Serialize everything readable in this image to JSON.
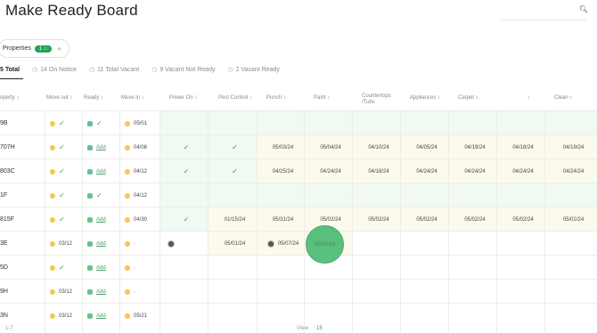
{
  "page": {
    "title": "Make Ready Board"
  },
  "search": {
    "placeholder": ""
  },
  "properties_filter": {
    "label": "Properties",
    "count": "1",
    "add": "+"
  },
  "tabs": [
    {
      "label": "5 Total",
      "icon": ""
    },
    {
      "label": "14 On Notice",
      "icon": "clock-icon"
    },
    {
      "label": "11 Total Vacant",
      "icon": "clock-icon"
    },
    {
      "label": "9 Vacant Not Ready",
      "icon": "clock-icon"
    },
    {
      "label": "2 Vacant Ready",
      "icon": "clock-icon"
    }
  ],
  "columns": [
    "operty ↕",
    "Move out ↕",
    "Ready ↕",
    "Move in ↕",
    "Power On ↕",
    "Pest Control ↕",
    "Punch ↕",
    "Paint ↕",
    "Countertops /Tubs",
    "Appliances ↕",
    "Carpet ↕",
    "↕",
    "Clean ↕"
  ],
  "rows": [
    {
      "property": "9B",
      "moveout_date": "",
      "ready": "check",
      "movein": "05/01",
      "power": "",
      "pest": "",
      "punch": "",
      "paint": "",
      "counter": "",
      "appl": "",
      "carpet": "",
      "col11": "",
      "clean": ""
    },
    {
      "property": "707H",
      "moveout_date": "",
      "ready": "add",
      "movein": "04/08",
      "power": "check",
      "pest": "check",
      "punch": "05/03/24",
      "paint": "05/04/24",
      "counter": "04/10/24",
      "appl": "04/05/24",
      "carpet": "04/19/24",
      "col11": "04/18/24",
      "clean": "04/19/24"
    },
    {
      "property": "803C",
      "moveout_date": "",
      "ready": "add",
      "movein": "04/12",
      "power": "check",
      "pest": "check",
      "punch": "04/25/24",
      "paint": "04/24/24",
      "counter": "04/18/24",
      "appl": "04/24/24",
      "carpet": "04/24/24",
      "col11": "04/24/24",
      "clean": "04/24/24"
    },
    {
      "property": "1F",
      "moveout_date": "",
      "ready": "check",
      "movein": "04/12",
      "power": "",
      "pest": "",
      "punch": "",
      "paint": "",
      "counter": "",
      "appl": "",
      "carpet": "",
      "col11": "",
      "clean": ""
    },
    {
      "property": "815F",
      "moveout_date": "",
      "ready": "add",
      "movein": "04/30",
      "power": "check",
      "pest": "01/15/24",
      "punch": "05/31/24",
      "paint": "05/02/24",
      "counter": "05/02/24",
      "appl": "05/02/24",
      "carpet": "05/02/24",
      "col11": "05/02/24",
      "clean": "05/02/24"
    },
    {
      "property": "3E",
      "moveout_date": "03/12",
      "ready": "add",
      "movein": "-",
      "power": "avatar",
      "pest": "05/01/24",
      "punch": "05/07/24",
      "paint": "05/02/24",
      "counter": "",
      "appl": "",
      "carpet": "",
      "col11": "",
      "clean": ""
    },
    {
      "property": "5D",
      "moveout_date": "",
      "ready": "add",
      "movein": "-",
      "power": "",
      "pest": "",
      "punch": "",
      "paint": "",
      "counter": "",
      "appl": "",
      "carpet": "",
      "col11": "",
      "clean": ""
    },
    {
      "property": "9H",
      "moveout_date": "03/12",
      "ready": "add",
      "movein": "-",
      "power": "",
      "pest": "",
      "punch": "",
      "paint": "",
      "counter": "",
      "appl": "",
      "carpet": "",
      "col11": "",
      "clean": ""
    },
    {
      "property": "3N",
      "moveout_date": "03/12",
      "ready": "add",
      "movein": "05/21",
      "power": "",
      "pest": "",
      "punch": "",
      "paint": "",
      "counter": "",
      "appl": "",
      "carpet": "",
      "col11": "",
      "clean": ""
    }
  ],
  "labels": {
    "add": "Add",
    "check": "✓",
    "dash": "-"
  },
  "footer": {
    "pagination": "1-7",
    "view_label": "View",
    "view_value": "15"
  },
  "colors": {
    "accent": "#22a35a",
    "row_green": "#f1f9f3",
    "row_yellow": "#fcfaec"
  }
}
